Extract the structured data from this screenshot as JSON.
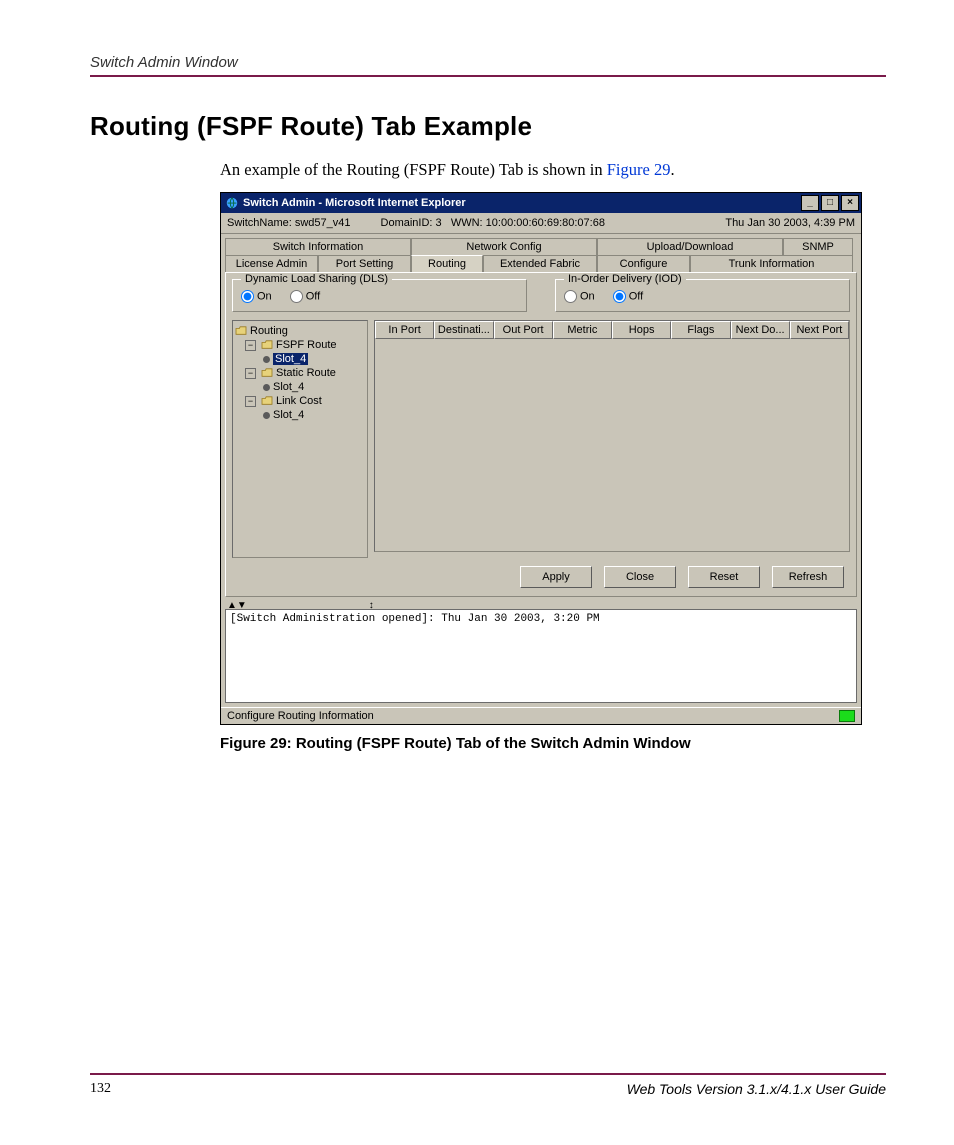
{
  "page": {
    "running_head": "Switch Admin Window",
    "section_title": "Routing (FSPF Route) Tab Example",
    "body_text_pre": "An example of the Routing (FSPF Route) Tab is shown in ",
    "figure_ref": "Figure 29",
    "body_text_post": ".",
    "figure_caption": "Figure 29:  Routing (FSPF Route) Tab of the Switch Admin Window",
    "footer_page": "132",
    "footer_doc": "Web Tools Version 3.1.x/4.1.x User Guide"
  },
  "window": {
    "title": "Switch Admin - Microsoft Internet Explorer",
    "info": {
      "switch_name_label": "SwitchName:",
      "switch_name": "swd57_v41",
      "domain_label": "DomainID:",
      "domain_id": "3",
      "wwn_label": "WWN:",
      "wwn": "10:00:00:60:69:80:07:68",
      "datetime": "Thu Jan 30  2003, 4:39 PM"
    },
    "tabs_row1": [
      "Switch Information",
      "Network Config",
      "Upload/Download",
      "SNMP"
    ],
    "tabs_row2": [
      "License Admin",
      "Port Setting",
      "Routing",
      "Extended Fabric",
      "Configure",
      "Trunk Information"
    ],
    "active_tab": "Routing",
    "dls": {
      "title": "Dynamic Load Sharing (DLS)",
      "on": "On",
      "off": "Off",
      "selected": "On"
    },
    "iod": {
      "title": "In-Order Delivery (IOD)",
      "on": "On",
      "off": "Off",
      "selected": "Off"
    },
    "tree": {
      "root": "Routing",
      "nodes": [
        {
          "label": "FSPF Route",
          "children": [
            {
              "label": "Slot_4",
              "selected": true
            }
          ]
        },
        {
          "label": "Static Route",
          "children": [
            {
              "label": "Slot_4"
            }
          ]
        },
        {
          "label": "Link Cost",
          "children": [
            {
              "label": "Slot_4"
            }
          ]
        }
      ]
    },
    "columns": [
      "In Port",
      "Destinati...",
      "Out Port",
      "Metric",
      "Hops",
      "Flags",
      "Next Do...",
      "Next Port"
    ],
    "buttons": {
      "apply": "Apply",
      "close": "Close",
      "reset": "Reset",
      "refresh": "Refresh"
    },
    "log": "[Switch Administration opened]: Thu Jan 30  2003, 3:20 PM",
    "status": "Configure Routing Information"
  }
}
